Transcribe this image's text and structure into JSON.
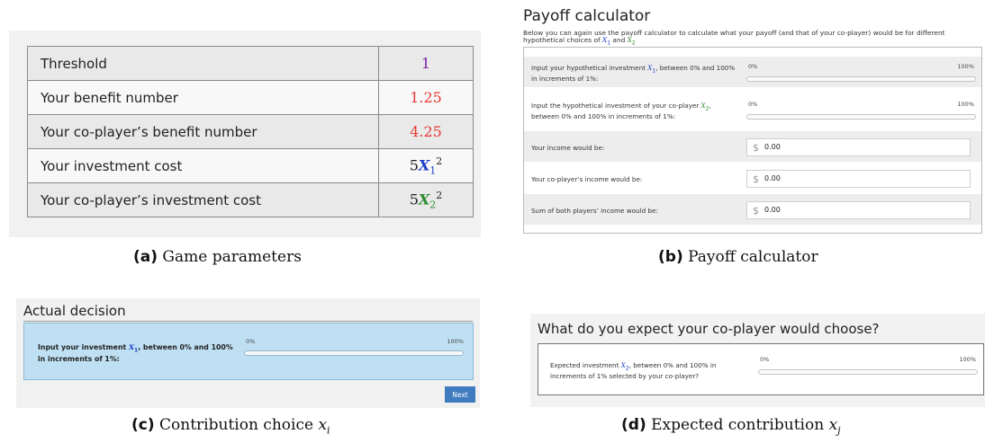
{
  "colors": {
    "threshold": "#7b1fa2",
    "benefit": "#e53935",
    "x1": "#1e40c8",
    "x2": "#2e8b2e",
    "next_button": "#3f7bbf",
    "decision_box": "#bfe0f3"
  },
  "panel_a": {
    "rows": [
      {
        "label": "Threshold",
        "value": "1"
      },
      {
        "label": "Your benefit number",
        "value": "1.25"
      },
      {
        "label": "Your co-player’s benefit number",
        "value": "4.25"
      },
      {
        "label": "Your investment cost",
        "coef": "5",
        "var": "X",
        "sub": "1",
        "sup": "2"
      },
      {
        "label": "Your co-player’s investment cost",
        "coef": "5",
        "var": "X",
        "sub": "2",
        "sup": "2"
      }
    ],
    "caption_letter": "(a)",
    "caption_text": "Game parameters"
  },
  "panel_b": {
    "title": "Payoff calculator",
    "desc_pre": "Below you can again use the payoff calculator to calculate what your payoff (and that of your co-player) would be for different hypothetical choices of ",
    "desc_and": " and ",
    "var": "X",
    "sub1": "1",
    "sub2": "2",
    "slider1": {
      "pre": "Input your hypothetical investment ",
      "post": ", between 0% and 100% in increments of 1%:",
      "min": "0%",
      "max": "100%"
    },
    "slider2": {
      "pre": "Input the hypothetical investment of your co-player ",
      "post": ", between 0% and 100% in increments of 1%:",
      "min": "0%",
      "max": "100%"
    },
    "outputs": [
      {
        "label": "Your income would be:",
        "currency": "$",
        "amount": "0.00"
      },
      {
        "label": "Your co-player’s income would be:",
        "currency": "$",
        "amount": "0.00"
      },
      {
        "label": "Sum of both players’ income would be:",
        "currency": "$",
        "amount": "0.00"
      }
    ],
    "caption_letter": "(b)",
    "caption_text": "Payoff calculator"
  },
  "panel_c": {
    "title": "Actual decision",
    "label_pre": "Input your investment ",
    "label_post": ", between 0% and 100% in increments of 1%:",
    "var": "X",
    "sub": "1",
    "min": "0%",
    "max": "100%",
    "next": "Next",
    "caption_letter": "(c)",
    "caption_text": "Contribution choice ",
    "caption_var": "x",
    "caption_sub": "i"
  },
  "panel_d": {
    "title": "What do you expect your co-player would choose?",
    "label_pre": "Expected investment ",
    "label_post": ", between 0% and 100% in increments of 1% selected by your co-player?",
    "var": "X",
    "sub": "2",
    "min": "0%",
    "max": "100%",
    "caption_letter": "(d)",
    "caption_text": "Expected contribution ",
    "caption_var": "x",
    "caption_sub": "j"
  }
}
